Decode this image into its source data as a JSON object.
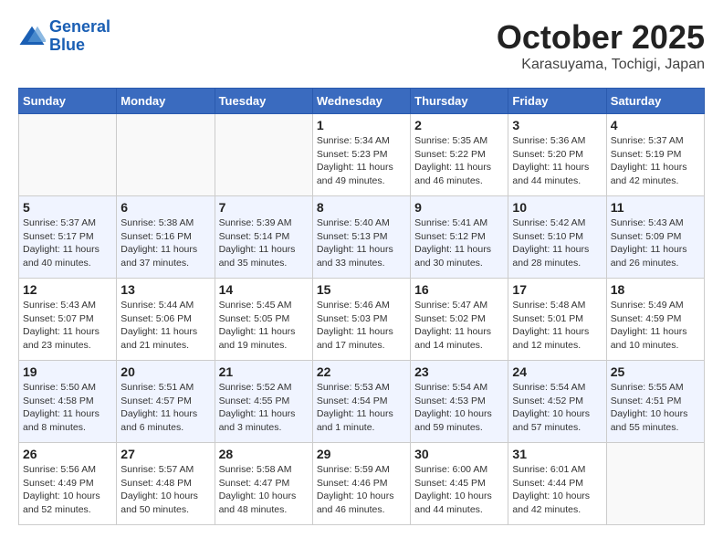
{
  "header": {
    "logo_line1": "General",
    "logo_line2": "Blue",
    "month_title": "October 2025",
    "location": "Karasuyama, Tochigi, Japan"
  },
  "days_of_week": [
    "Sunday",
    "Monday",
    "Tuesday",
    "Wednesday",
    "Thursday",
    "Friday",
    "Saturday"
  ],
  "weeks": [
    [
      {
        "day": "",
        "info": ""
      },
      {
        "day": "",
        "info": ""
      },
      {
        "day": "",
        "info": ""
      },
      {
        "day": "1",
        "info": "Sunrise: 5:34 AM\nSunset: 5:23 PM\nDaylight: 11 hours\nand 49 minutes."
      },
      {
        "day": "2",
        "info": "Sunrise: 5:35 AM\nSunset: 5:22 PM\nDaylight: 11 hours\nand 46 minutes."
      },
      {
        "day": "3",
        "info": "Sunrise: 5:36 AM\nSunset: 5:20 PM\nDaylight: 11 hours\nand 44 minutes."
      },
      {
        "day": "4",
        "info": "Sunrise: 5:37 AM\nSunset: 5:19 PM\nDaylight: 11 hours\nand 42 minutes."
      }
    ],
    [
      {
        "day": "5",
        "info": "Sunrise: 5:37 AM\nSunset: 5:17 PM\nDaylight: 11 hours\nand 40 minutes."
      },
      {
        "day": "6",
        "info": "Sunrise: 5:38 AM\nSunset: 5:16 PM\nDaylight: 11 hours\nand 37 minutes."
      },
      {
        "day": "7",
        "info": "Sunrise: 5:39 AM\nSunset: 5:14 PM\nDaylight: 11 hours\nand 35 minutes."
      },
      {
        "day": "8",
        "info": "Sunrise: 5:40 AM\nSunset: 5:13 PM\nDaylight: 11 hours\nand 33 minutes."
      },
      {
        "day": "9",
        "info": "Sunrise: 5:41 AM\nSunset: 5:12 PM\nDaylight: 11 hours\nand 30 minutes."
      },
      {
        "day": "10",
        "info": "Sunrise: 5:42 AM\nSunset: 5:10 PM\nDaylight: 11 hours\nand 28 minutes."
      },
      {
        "day": "11",
        "info": "Sunrise: 5:43 AM\nSunset: 5:09 PM\nDaylight: 11 hours\nand 26 minutes."
      }
    ],
    [
      {
        "day": "12",
        "info": "Sunrise: 5:43 AM\nSunset: 5:07 PM\nDaylight: 11 hours\nand 23 minutes."
      },
      {
        "day": "13",
        "info": "Sunrise: 5:44 AM\nSunset: 5:06 PM\nDaylight: 11 hours\nand 21 minutes."
      },
      {
        "day": "14",
        "info": "Sunrise: 5:45 AM\nSunset: 5:05 PM\nDaylight: 11 hours\nand 19 minutes."
      },
      {
        "day": "15",
        "info": "Sunrise: 5:46 AM\nSunset: 5:03 PM\nDaylight: 11 hours\nand 17 minutes."
      },
      {
        "day": "16",
        "info": "Sunrise: 5:47 AM\nSunset: 5:02 PM\nDaylight: 11 hours\nand 14 minutes."
      },
      {
        "day": "17",
        "info": "Sunrise: 5:48 AM\nSunset: 5:01 PM\nDaylight: 11 hours\nand 12 minutes."
      },
      {
        "day": "18",
        "info": "Sunrise: 5:49 AM\nSunset: 4:59 PM\nDaylight: 11 hours\nand 10 minutes."
      }
    ],
    [
      {
        "day": "19",
        "info": "Sunrise: 5:50 AM\nSunset: 4:58 PM\nDaylight: 11 hours\nand 8 minutes."
      },
      {
        "day": "20",
        "info": "Sunrise: 5:51 AM\nSunset: 4:57 PM\nDaylight: 11 hours\nand 6 minutes."
      },
      {
        "day": "21",
        "info": "Sunrise: 5:52 AM\nSunset: 4:55 PM\nDaylight: 11 hours\nand 3 minutes."
      },
      {
        "day": "22",
        "info": "Sunrise: 5:53 AM\nSunset: 4:54 PM\nDaylight: 11 hours\nand 1 minute."
      },
      {
        "day": "23",
        "info": "Sunrise: 5:54 AM\nSunset: 4:53 PM\nDaylight: 10 hours\nand 59 minutes."
      },
      {
        "day": "24",
        "info": "Sunrise: 5:54 AM\nSunset: 4:52 PM\nDaylight: 10 hours\nand 57 minutes."
      },
      {
        "day": "25",
        "info": "Sunrise: 5:55 AM\nSunset: 4:51 PM\nDaylight: 10 hours\nand 55 minutes."
      }
    ],
    [
      {
        "day": "26",
        "info": "Sunrise: 5:56 AM\nSunset: 4:49 PM\nDaylight: 10 hours\nand 52 minutes."
      },
      {
        "day": "27",
        "info": "Sunrise: 5:57 AM\nSunset: 4:48 PM\nDaylight: 10 hours\nand 50 minutes."
      },
      {
        "day": "28",
        "info": "Sunrise: 5:58 AM\nSunset: 4:47 PM\nDaylight: 10 hours\nand 48 minutes."
      },
      {
        "day": "29",
        "info": "Sunrise: 5:59 AM\nSunset: 4:46 PM\nDaylight: 10 hours\nand 46 minutes."
      },
      {
        "day": "30",
        "info": "Sunrise: 6:00 AM\nSunset: 4:45 PM\nDaylight: 10 hours\nand 44 minutes."
      },
      {
        "day": "31",
        "info": "Sunrise: 6:01 AM\nSunset: 4:44 PM\nDaylight: 10 hours\nand 42 minutes."
      },
      {
        "day": "",
        "info": ""
      }
    ]
  ]
}
